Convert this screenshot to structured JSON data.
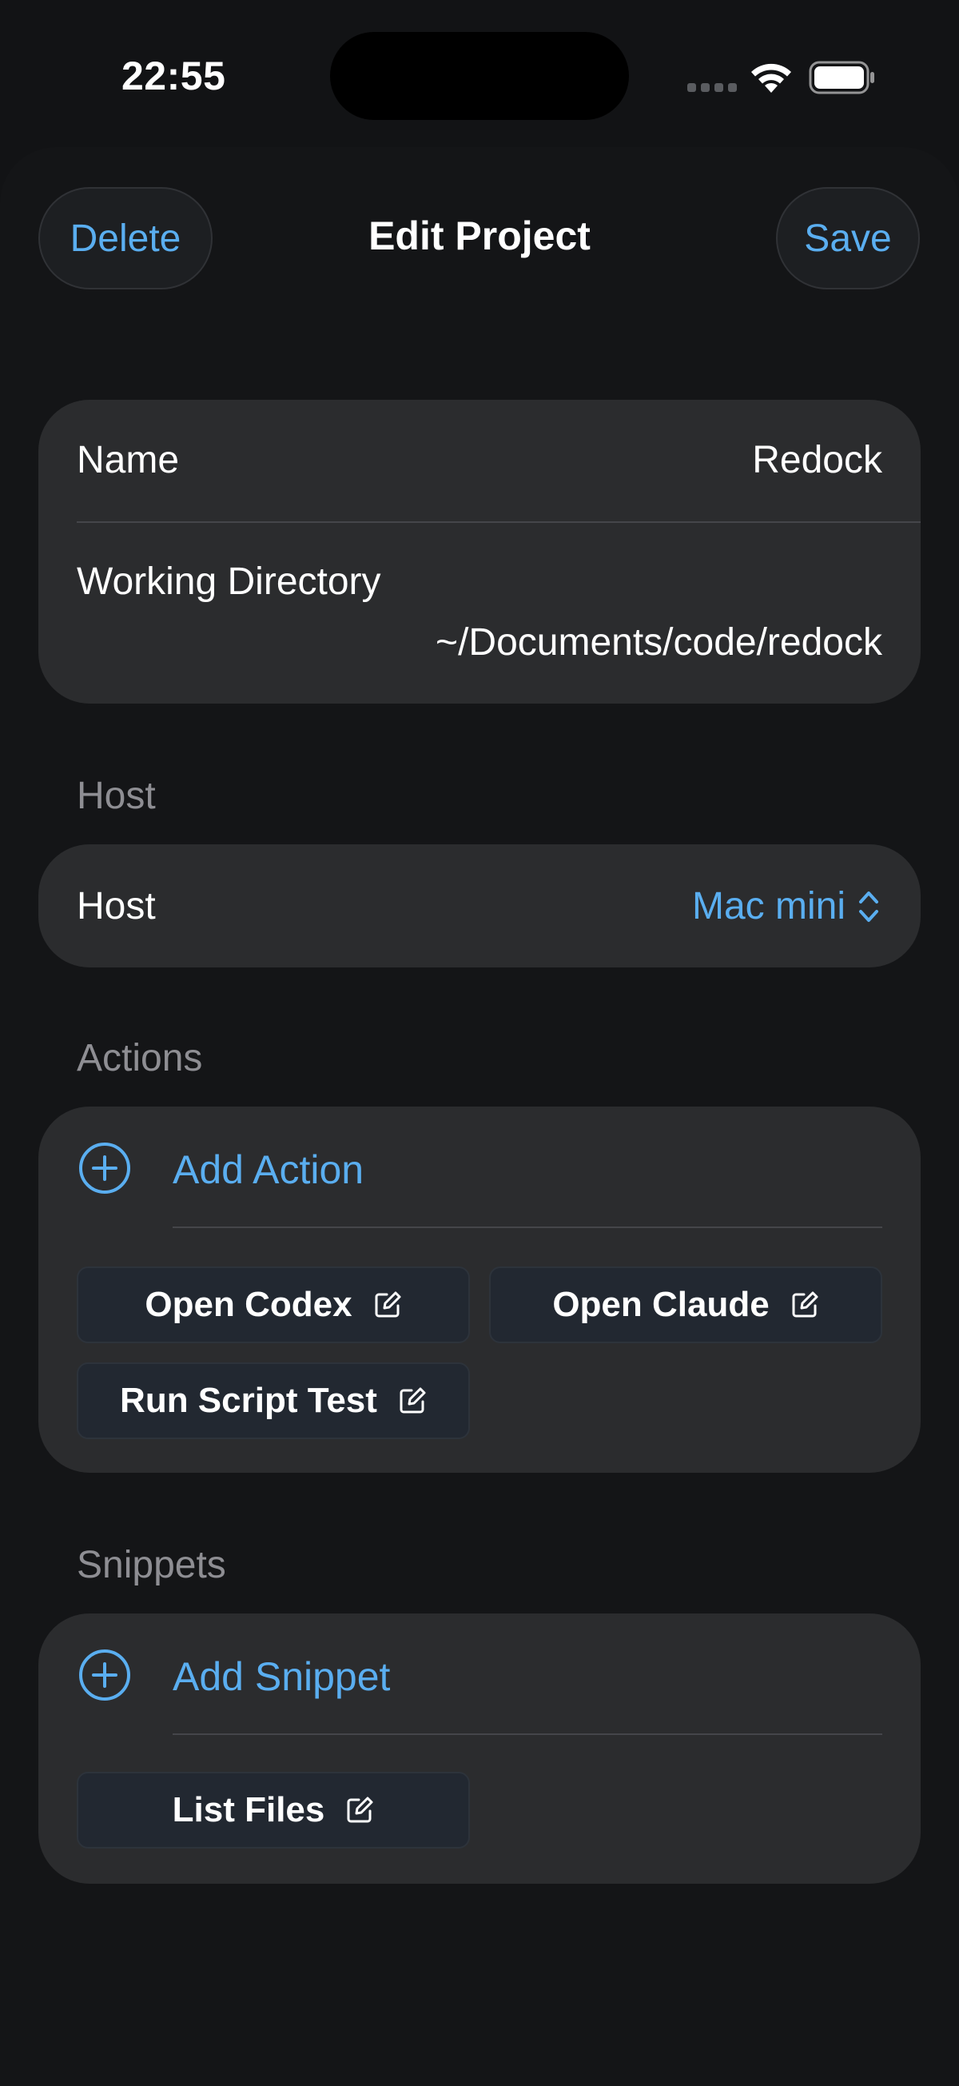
{
  "status_bar": {
    "time": "22:55",
    "wifi_icon": "wifi-icon",
    "battery_icon": "battery-icon"
  },
  "nav": {
    "delete_label": "Delete",
    "title": "Edit Project",
    "save_label": "Save"
  },
  "project": {
    "name_label": "Name",
    "name_value": "Redock",
    "dir_label": "Working Directory",
    "dir_value": "~/Documents/code/redock"
  },
  "host_section": {
    "header": "Host",
    "label": "Host",
    "value": "Mac mini",
    "value_icon": "chevron-up-down-icon"
  },
  "actions_section": {
    "header": "Actions",
    "add_label": "Add Action",
    "add_icon": "plus-circle-icon",
    "items": [
      {
        "label": "Open Codex",
        "icon": "edit-icon"
      },
      {
        "label": "Open Claude",
        "icon": "edit-icon"
      },
      {
        "label": "Run Script Test",
        "icon": "edit-icon"
      }
    ]
  },
  "snippets_section": {
    "header": "Snippets",
    "add_label": "Add Snippet",
    "add_icon": "plus-circle-icon",
    "items": [
      {
        "label": "List Files",
        "icon": "edit-icon"
      }
    ]
  },
  "colors": {
    "accent": "#5aaef0",
    "background": "#121315",
    "card": "#2b2c2e",
    "chip": "#222831",
    "secondary_text": "#8e8e93"
  }
}
